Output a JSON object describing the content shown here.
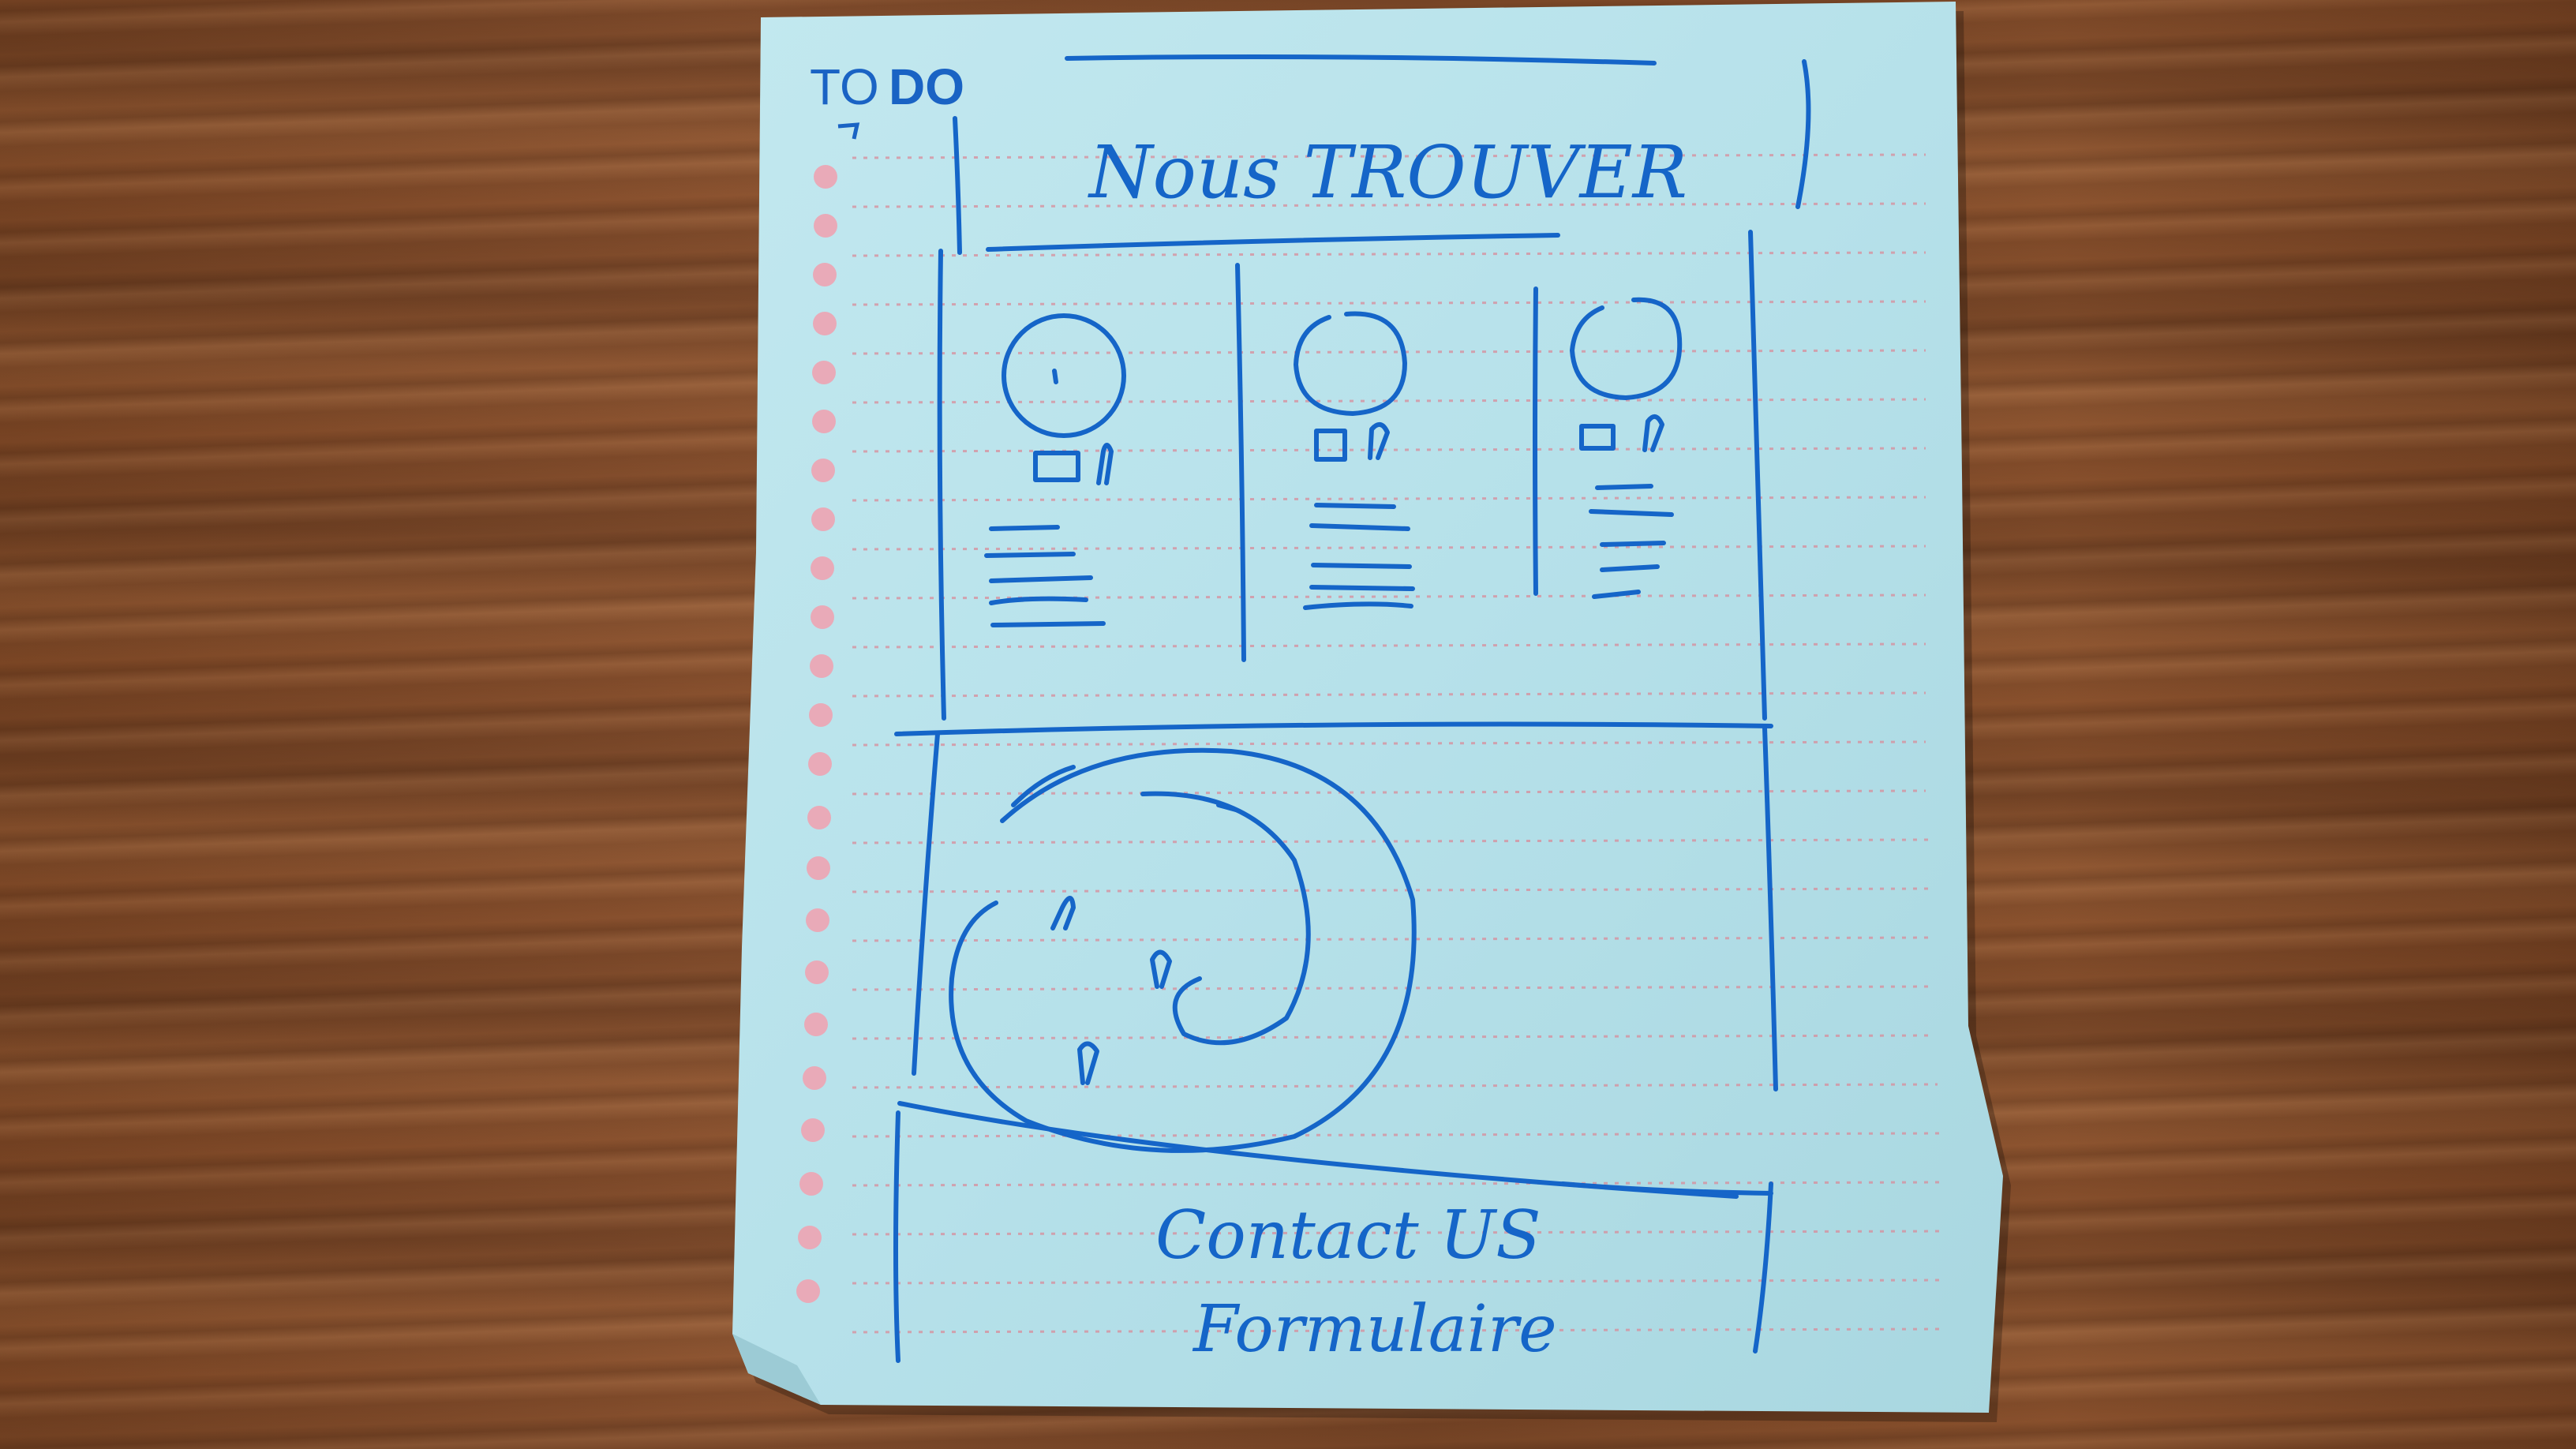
{
  "notebook": {
    "header_thin": "TO",
    "header_bold": "DO"
  },
  "sketch": {
    "title": "Nous TROUVER",
    "footer_line1": "Contact US",
    "footer_line2": "Formulaire"
  },
  "colors": {
    "ink": "#1565c8",
    "paper": "#b9e4ec",
    "hole": "#e9aab8",
    "dotted_rule": "#d98c9a",
    "wood": "#7a4524"
  },
  "icons": {
    "card_icon": "location-pin-icon",
    "map_marker": "location-pin-icon"
  }
}
